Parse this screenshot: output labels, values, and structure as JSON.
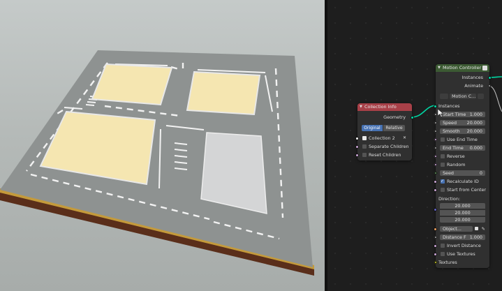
{
  "colors": {
    "motion_header": "#3c5a33",
    "collection_header": "#a84048",
    "geometry_socket": "#00d6a3",
    "float_socket": "#a1a1a1",
    "bool_socket": "#cca6d6",
    "object_socket": "#ed9e5c",
    "vector_socket": "#6363c7",
    "int_socket": "#5f8d5a",
    "field_active": "#4772b3",
    "building_fill": "#f5e6b1",
    "plot_fill": "#d4d5d6",
    "ground_top": "#8e9291",
    "ground_side": "#c49a3b"
  },
  "collection_info": {
    "title": "Collection Info",
    "output_geometry": "Geometry",
    "mode_original": "Original",
    "mode_relative": "Relative",
    "collection_icon": "collection-icon",
    "collection_value": "Collection 2",
    "separate_children": "Separate Children",
    "reset_children": "Reset Children"
  },
  "motion_controller": {
    "title": "Motion Controller",
    "out_instances": "Instances",
    "out_animate": "Animate",
    "dropdown_value": "Motion C...",
    "in_instances": "Instances",
    "start_time_label": "Start Time",
    "start_time_value": "1.000",
    "speed_label": "Speed",
    "speed_value": "20.000",
    "smooth_label": "Smooth",
    "smooth_value": "20.000",
    "use_end_time": "Use End Time",
    "end_time_label": "End Time",
    "end_time_value": "0.000",
    "reverse": "Reverse",
    "random": "Random",
    "seed_label": "Seed",
    "seed_value": "0",
    "recalculate_id": "Recalculate ID",
    "recalculate_id_checked": true,
    "start_from_center": "Start from Center",
    "direction_label": "Direction:",
    "direction_x": "20.000",
    "direction_y": "20.000",
    "direction_z": "20.000",
    "object_label": "Object...",
    "distance_label": "Distance F",
    "distance_value": "1.000",
    "invert_distance": "Invert Distance",
    "use_textures": "Use Textures",
    "textures": "Textures"
  }
}
